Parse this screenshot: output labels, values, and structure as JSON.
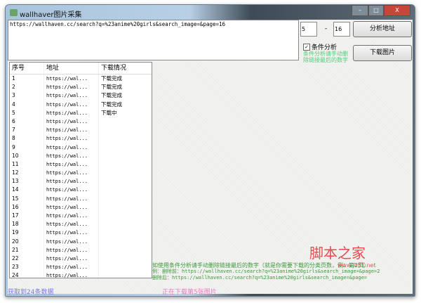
{
  "window": {
    "title": "wallhaver图片采集",
    "controls": [
      "–",
      "□",
      "X"
    ]
  },
  "url_input": {
    "value": "https://wallhaven.cc/search?q=%23anime%20girls&search_image=&page=16"
  },
  "range": {
    "from": "5",
    "separator": "-",
    "to": "16"
  },
  "buttons": {
    "analyze": "分析地址",
    "download": "下载图片"
  },
  "checkbox": {
    "label": "条件分析",
    "checked": true
  },
  "hint_small": "条件分析请手动删除链接最后的数字",
  "table": {
    "headers": [
      "序号",
      "地址",
      "下载情况"
    ],
    "rows": [
      [
        "1",
        "https://wal...",
        "下载完成"
      ],
      [
        "2",
        "https://wal...",
        "下载完成"
      ],
      [
        "3",
        "https://wal...",
        "下载完成"
      ],
      [
        "4",
        "https://wal...",
        "下载完成"
      ],
      [
        "5",
        "https://wal...",
        "下载中"
      ],
      [
        "6",
        "https://wal...",
        ""
      ],
      [
        "7",
        "https://wal...",
        ""
      ],
      [
        "8",
        "https://wal...",
        ""
      ],
      [
        "9",
        "https://wal...",
        ""
      ],
      [
        "10",
        "https://wal...",
        ""
      ],
      [
        "11",
        "https://wal...",
        ""
      ],
      [
        "12",
        "https://wal...",
        ""
      ],
      [
        "13",
        "https://wal...",
        ""
      ],
      [
        "14",
        "https://wal...",
        ""
      ],
      [
        "15",
        "https://wal...",
        ""
      ],
      [
        "16",
        "https://wal...",
        ""
      ],
      [
        "17",
        "https://wal...",
        ""
      ],
      [
        "18",
        "https://wal...",
        ""
      ],
      [
        "19",
        "https://wal...",
        ""
      ],
      [
        "20",
        "https://wal...",
        ""
      ],
      [
        "21",
        "https://wal...",
        ""
      ],
      [
        "22",
        "https://wal...",
        ""
      ],
      [
        "23",
        "https://wal...",
        ""
      ],
      [
        "24",
        "https://wal...",
        ""
      ]
    ]
  },
  "instructions": [
    "如使用条件分析请手动删除链接最后的数字（就是你需要下载的分类页数，例：第2页）",
    "例：删除前：https://wallhaven.cc/search?q=%23anime%20girls&search_image=&page=2",
    "删除后：https://wallhaven.cc/search?q=%23anime%20girls&search_image=&page="
  ],
  "status": {
    "count": "获取到24条数据",
    "progress": "正在下载第5张图片"
  },
  "watermark": {
    "title": "脚本之家",
    "url": "www.jb51.net"
  }
}
